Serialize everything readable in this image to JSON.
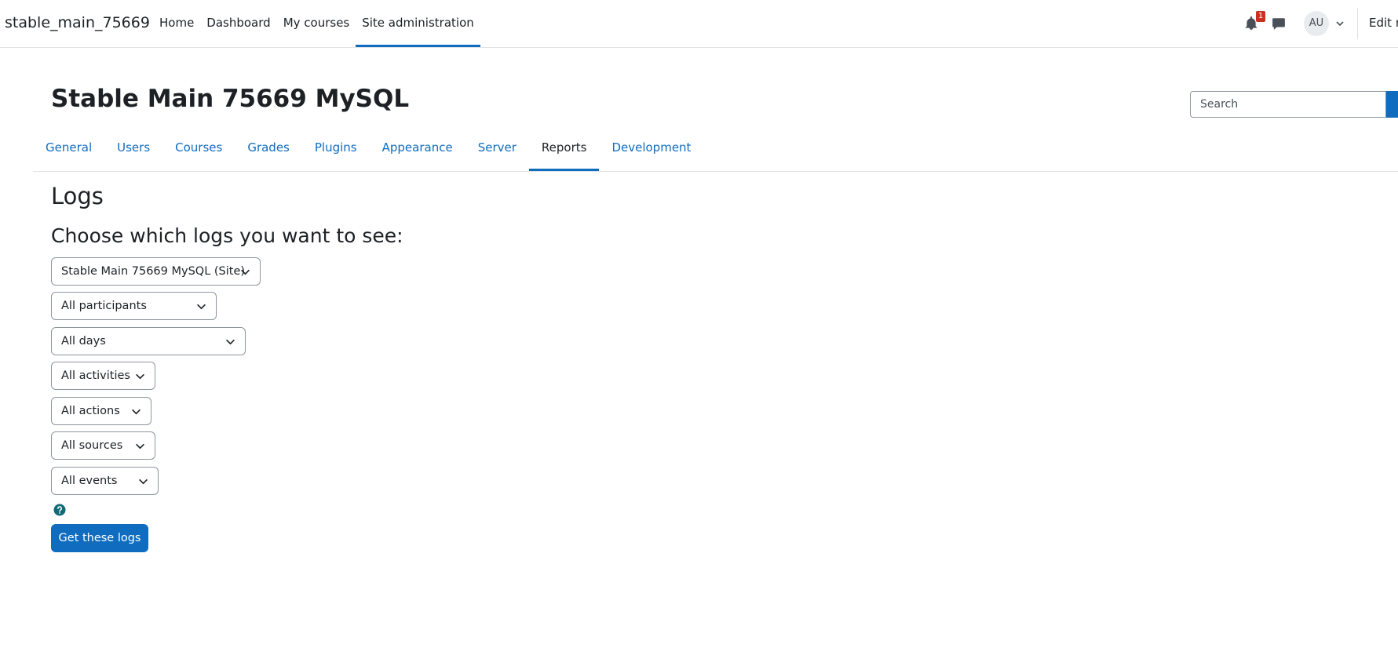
{
  "navbar": {
    "brand": "stable_main_75669",
    "links": [
      {
        "label": "Home"
      },
      {
        "label": "Dashboard"
      },
      {
        "label": "My courses"
      },
      {
        "label": "Site administration"
      }
    ],
    "notification_count": "1",
    "avatar_initials": "AU",
    "edit_mode_label": "Edit m"
  },
  "header": {
    "title": "Stable Main 75669 MySQL",
    "search_placeholder": "Search"
  },
  "tabs": [
    {
      "label": "General"
    },
    {
      "label": "Users"
    },
    {
      "label": "Courses"
    },
    {
      "label": "Grades"
    },
    {
      "label": "Plugins"
    },
    {
      "label": "Appearance"
    },
    {
      "label": "Server"
    },
    {
      "label": "Reports"
    },
    {
      "label": "Development"
    }
  ],
  "main": {
    "heading": "Logs",
    "subheading": "Choose which logs you want to see:",
    "filters": {
      "site": "Stable Main 75669 MySQL (Site)",
      "participants": "All participants",
      "days": "All days",
      "activities": "All activities",
      "actions": "All actions",
      "sources": "All sources",
      "events": "All events"
    },
    "submit_label": "Get these logs"
  },
  "colors": {
    "accent": "#0f6cbf",
    "badge": "#ca3120",
    "help": "#0f6b77"
  }
}
